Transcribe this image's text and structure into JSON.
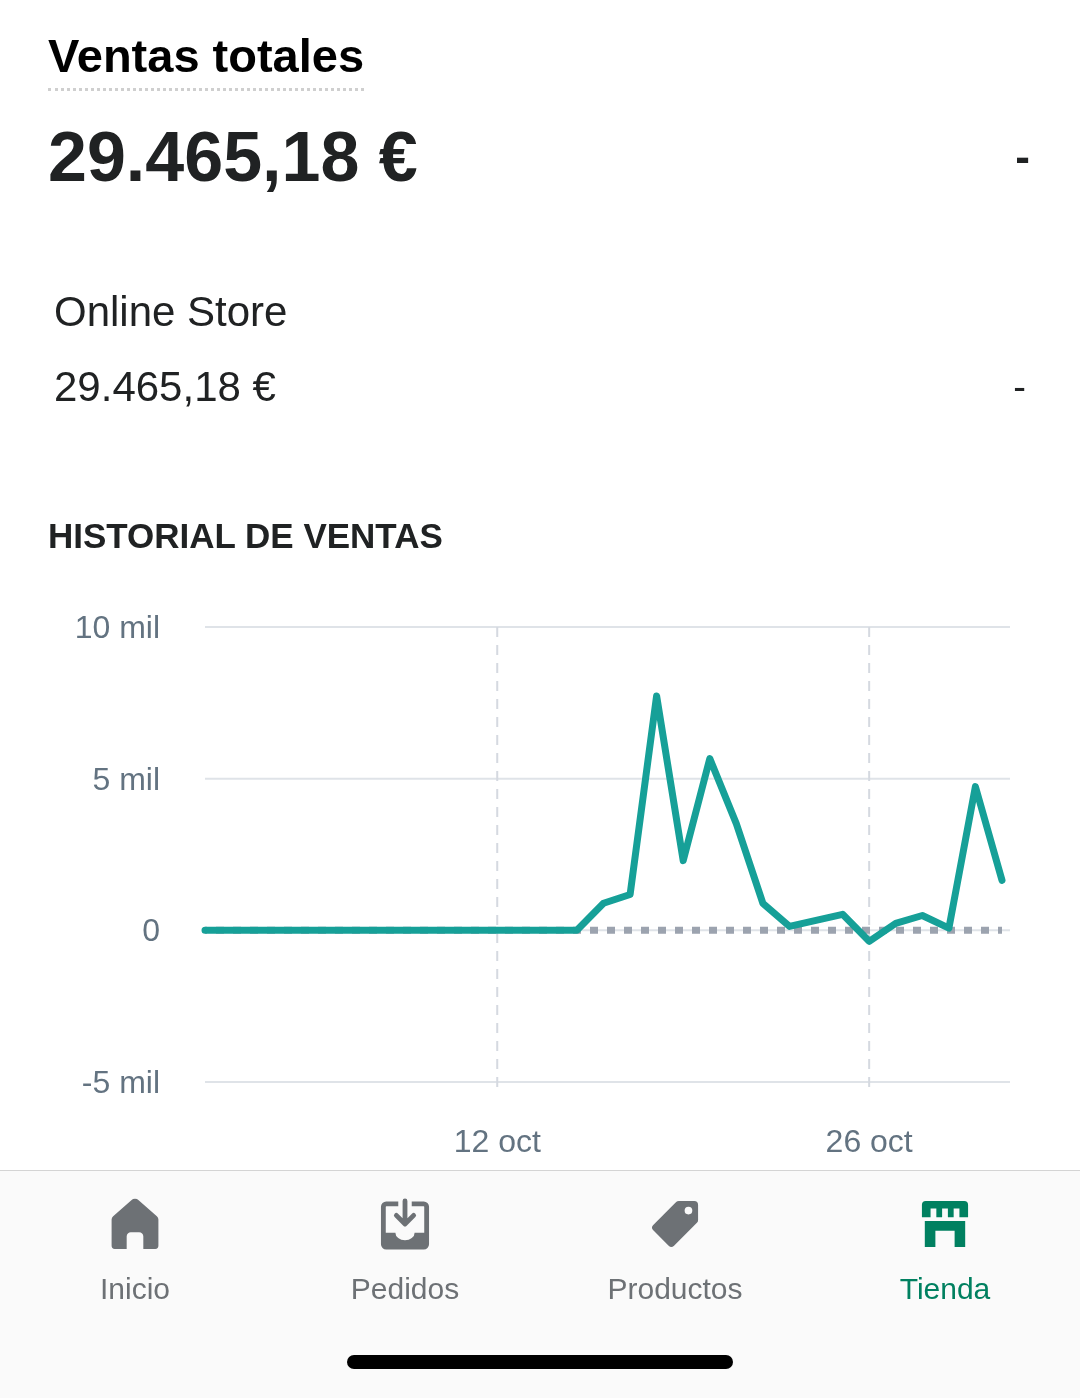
{
  "summary": {
    "title": "Ventas totales",
    "total": "29.465,18 €",
    "change": "-"
  },
  "channels": [
    {
      "name": "Online Store",
      "amount": "29.465,18 €",
      "change": "-"
    }
  ],
  "sales_history": {
    "chart_data": {
      "type": "line",
      "title": "HISTORIAL DE VENTAS",
      "categories": [
        null,
        null,
        null,
        null,
        null,
        null,
        null,
        null,
        null,
        null,
        null,
        "12 oct",
        null,
        null,
        null,
        null,
        null,
        null,
        null,
        null,
        null,
        null,
        null,
        null,
        null,
        "26 oct",
        null,
        null,
        null,
        null,
        null
      ],
      "series": [
        {
          "color": "#9ca3af",
          "line_style": "dotted",
          "values": [
            0,
            0,
            0,
            0,
            0,
            0,
            0,
            0,
            0,
            0,
            0,
            0,
            0,
            0,
            0,
            0,
            0,
            0,
            0,
            0,
            0,
            0,
            0,
            0,
            0,
            0,
            0,
            0,
            0,
            0,
            0
          ]
        },
        {
          "color": "#16a098",
          "line_style": "solid",
          "values": [
            0,
            0,
            0,
            0,
            0,
            0,
            0,
            0,
            0,
            0,
            0,
            0,
            0,
            0,
            0,
            0.89,
            1.18,
            7.73,
            2.3,
            5.66,
            3.52,
            0.89,
            0.13,
            0.33,
            0.53,
            -0.36,
            0.23,
            0.49,
            0.07,
            4.74,
            1.65
          ]
        }
      ],
      "ylim": [
        -5,
        10
      ],
      "yticks": [
        {
          "value": 10,
          "label": "10 mil"
        },
        {
          "value": 5,
          "label": "5 mil"
        },
        {
          "value": 0,
          "label": "0"
        },
        {
          "value": -5,
          "label": "-5 mil"
        }
      ],
      "grid": true
    }
  },
  "tab_bar": {
    "tabs": [
      {
        "label": "Inicio",
        "selected": false
      },
      {
        "label": "Pedidos",
        "selected": false
      },
      {
        "label": "Productos",
        "selected": false
      },
      {
        "label": "Tienda",
        "selected": true
      }
    ]
  }
}
